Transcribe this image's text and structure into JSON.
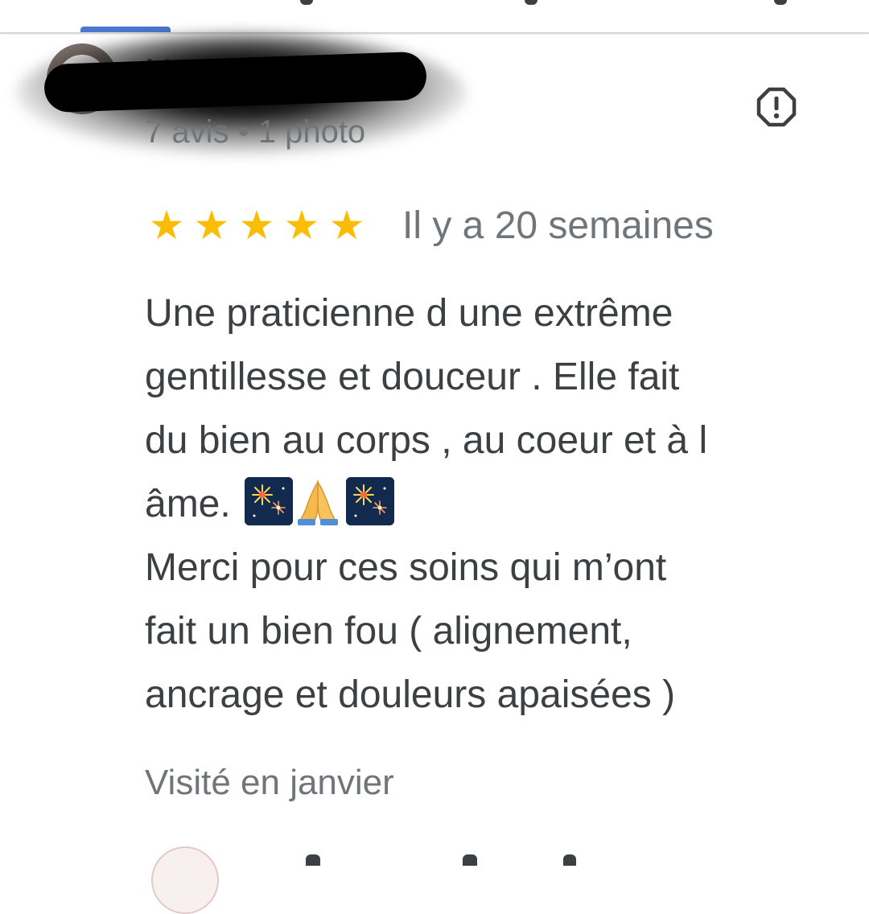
{
  "reviewer": {
    "name": "M",
    "meta": "7 avis • 1 photo"
  },
  "review": {
    "rating": 5,
    "max_rating": 5,
    "stars": [
      "★",
      "★",
      "★",
      "★",
      "★"
    ],
    "date": "Il y a 20 semaines",
    "text_lines": [
      "Une praticienne d une extrême",
      "gentillesse et douceur . Elle fait",
      "du bien au corps , au coeur et à l",
      "âme.",
      "Merci pour ces soins qui m’ont",
      "fait un bien fou ( alignement,",
      "ancrage et douleurs apaisées )"
    ],
    "emojis": [
      "fireworks",
      "folded-hands",
      "fireworks"
    ],
    "visited": "Visité en janvier"
  },
  "icons": {
    "report": "report-icon",
    "star_color": "#fbbc04"
  },
  "colors": {
    "accent": "#4a78d0",
    "text_primary": "#3c4043",
    "text_secondary": "#70757a"
  }
}
